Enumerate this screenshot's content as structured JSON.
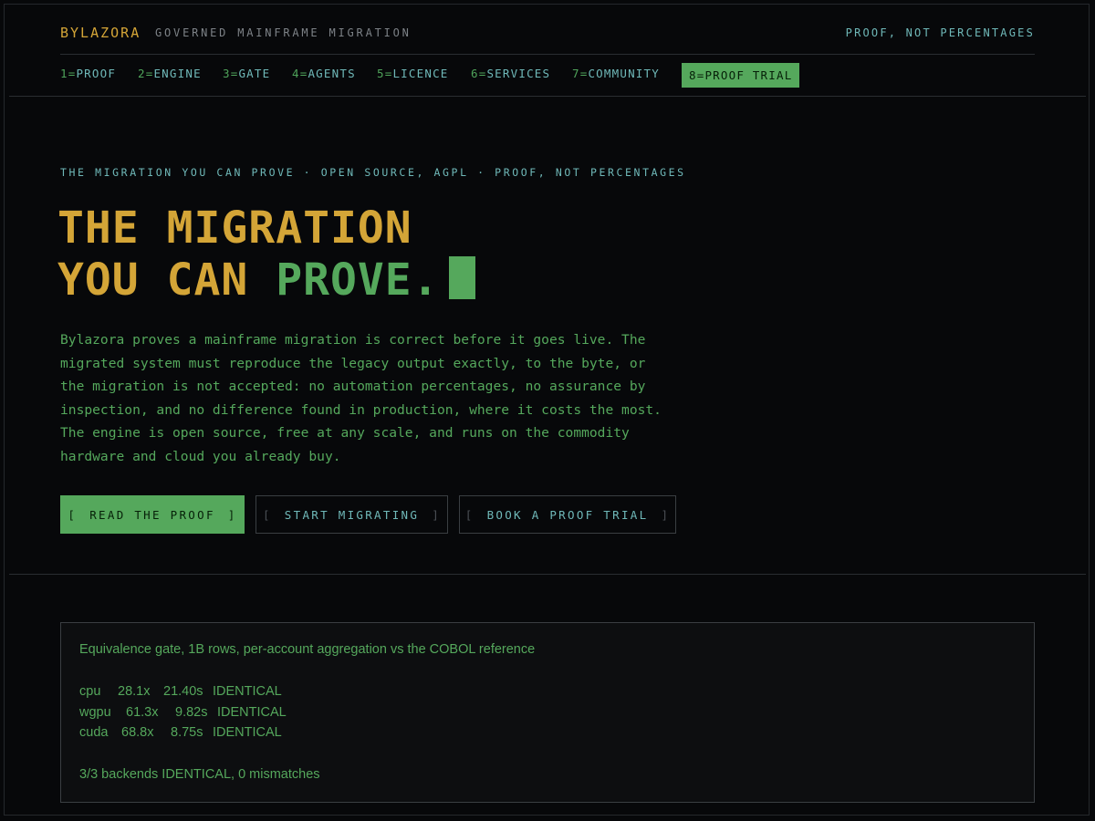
{
  "header": {
    "brand": "BYLAZORA",
    "tagline": "GOVERNED MAINFRAME MIGRATION",
    "motto": "PROOF, NOT PERCENTAGES"
  },
  "nav": [
    {
      "num": "1=",
      "label": "PROOF"
    },
    {
      "num": "2=",
      "label": "ENGINE"
    },
    {
      "num": "3=",
      "label": "GATE"
    },
    {
      "num": "4=",
      "label": "AGENTS"
    },
    {
      "num": "5=",
      "label": "LICENCE"
    },
    {
      "num": "6=",
      "label": "SERVICES"
    },
    {
      "num": "7=",
      "label": "COMMUNITY"
    },
    {
      "num": "8=",
      "label": "PROOF TRIAL",
      "active": true
    }
  ],
  "hero": {
    "eyebrow": "THE MIGRATION YOU CAN PROVE · OPEN SOURCE, AGPL · PROOF, NOT PERCENTAGES",
    "headline_line1": "THE MIGRATION",
    "headline_line2_a": "YOU CAN ",
    "headline_line2_b": "PROVE.",
    "lede": "Bylazora proves a mainframe migration is correct before it goes live. The migrated system must reproduce the legacy output exactly, to the byte, or the migration is not accepted: no automation percentages, no assurance by inspection, and no difference found in production, where it costs the most. The engine is open source, free at any scale, and runs on the commodity hardware and cloud you already buy.",
    "buttons": {
      "read": "READ THE PROOF",
      "start": "START MIGRATING",
      "book": "BOOK A PROOF TRIAL",
      "bracket_open": "[",
      "bracket_close": "]"
    }
  },
  "proof": {
    "title": "Equivalence gate, 1B rows, per-account aggregation vs the COBOL reference",
    "rows": [
      {
        "backend": "cpu",
        "speedup": "28.1x",
        "time": "21.40s",
        "result": "IDENTICAL"
      },
      {
        "backend": "wgpu",
        "speedup": "61.3x",
        "time": "9.82s",
        "result": "IDENTICAL"
      },
      {
        "backend": "cuda",
        "speedup": "68.8x",
        "time": "8.75s",
        "result": "IDENTICAL"
      }
    ],
    "summary": "3/3 backends IDENTICAL, 0 mismatches"
  },
  "colors": {
    "amber": "#d4a537",
    "green": "#55a85c",
    "teal": "#6fb8b8",
    "background": "#07080a"
  }
}
